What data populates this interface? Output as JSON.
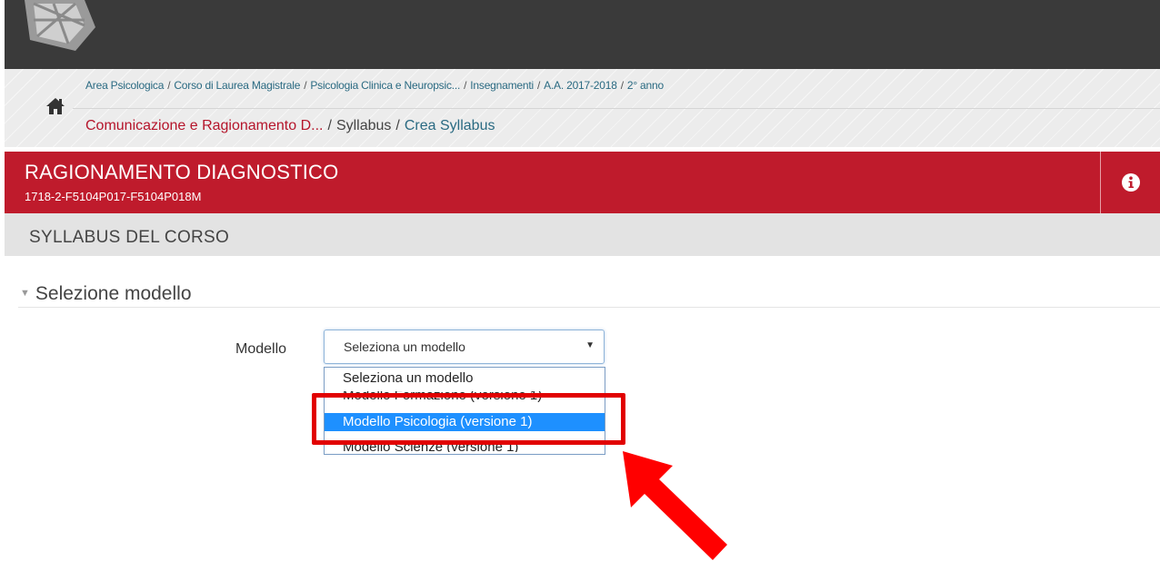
{
  "header": {
    "logo": "university-logo"
  },
  "breadcrumb": {
    "row1": [
      "Area Psicologica",
      "Corso di Laurea Magistrale",
      "Psicologia Clinica e Neuropsic...",
      "Insegnamenti",
      "A.A. 2017-2018",
      "2° anno"
    ],
    "separator": "/",
    "row2": {
      "course": "Comunicazione e Ragionamento D...",
      "syllabus": "Syllabus",
      "current": "Crea Syllabus"
    },
    "home_icon": "home-icon"
  },
  "course": {
    "title": "RAGIONAMENTO DIAGNOSTICO",
    "code": "1718-2-F5104P017-F5104P018M",
    "info_icon": "info-icon"
  },
  "section": {
    "title": "SYLLABUS DEL CORSO"
  },
  "form": {
    "legend": "Selezione modello",
    "field_label": "Modello",
    "select_value": "Seleziona un modello",
    "options": [
      "Seleziona un modello",
      "Modello Formazione (versione 1)",
      "Modello Psicologia (versione 1)",
      "Modello Scienze (versione 1)"
    ],
    "selected_index": 2
  },
  "colors": {
    "topbar": "#3a3a3a",
    "course_header": "#bf1b2c",
    "link_blue": "#2a6a82",
    "annotation_red": "#e10000",
    "option_highlight": "#1e90ff"
  }
}
